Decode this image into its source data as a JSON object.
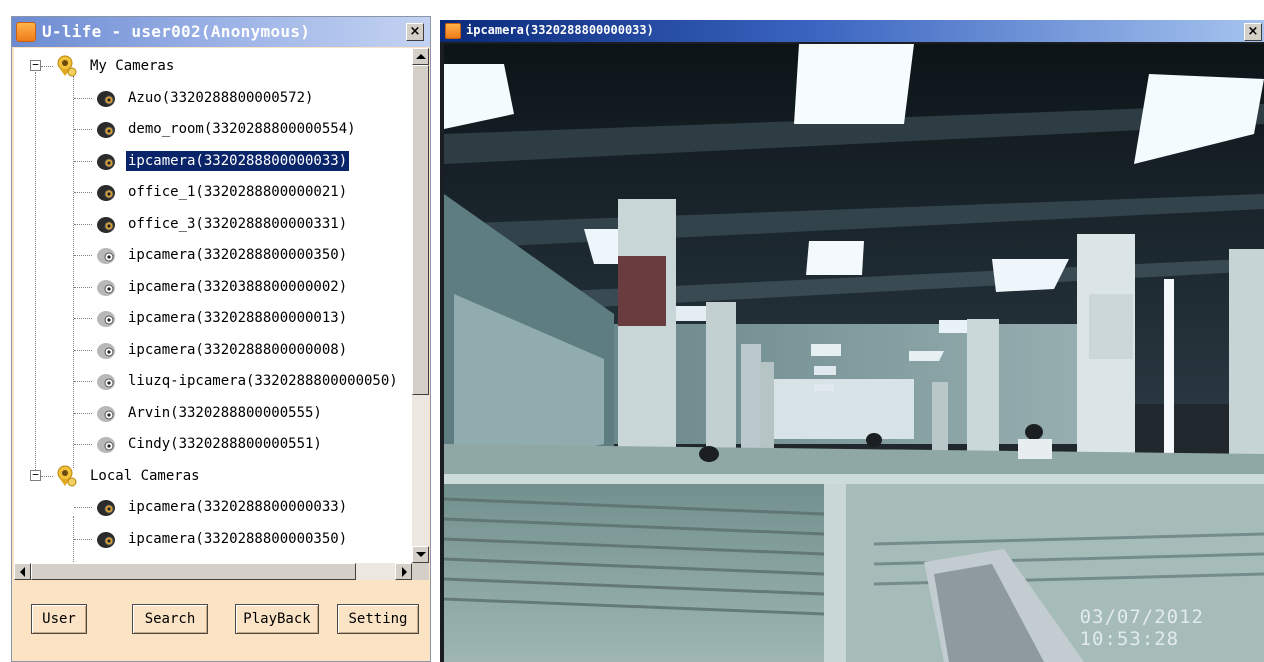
{
  "left_window": {
    "title": "U-life - user002(Anonymous)",
    "close": "×"
  },
  "tree": {
    "groups": [
      {
        "label": "My Cameras",
        "expander": "−",
        "items": [
          {
            "label": "Azuo(3320288800000572)",
            "online": true
          },
          {
            "label": "demo_room(3320288800000554)",
            "online": true
          },
          {
            "label": "ipcamera(3320288800000033)",
            "online": true,
            "selected": true
          },
          {
            "label": "office_1(3320288800000021)",
            "online": true
          },
          {
            "label": "office_3(3320288800000331)",
            "online": true
          },
          {
            "label": "ipcamera(3320288800000350)",
            "online": false
          },
          {
            "label": "ipcamera(3320388800000002)",
            "online": false
          },
          {
            "label": "ipcamera(3320288800000013)",
            "online": false
          },
          {
            "label": "ipcamera(3320288800000008)",
            "online": false
          },
          {
            "label": "liuzq-ipcamera(3320288800000050)",
            "online": false
          },
          {
            "label": "Arvin(3320288800000555)",
            "online": false
          },
          {
            "label": "Cindy(3320288800000551)",
            "online": false
          }
        ]
      },
      {
        "label": "Local Cameras",
        "expander": "−",
        "items": [
          {
            "label": "ipcamera(3320288800000033)",
            "online": true
          },
          {
            "label": "ipcamera(3320288800000350)",
            "online": true
          }
        ]
      }
    ]
  },
  "buttons": {
    "user": "User",
    "search": "Search",
    "playback": "PlayBack",
    "setting": "Setting"
  },
  "video_window": {
    "title": "ipcamera(3320288800000033)",
    "close": "×",
    "osd_date": "03/07/2012",
    "osd_time": "10:53:28"
  },
  "colors": {
    "panel_bg": "#fbe3c4",
    "selection": "#0a246a",
    "title_gradient_start": "#0a2a7a"
  }
}
